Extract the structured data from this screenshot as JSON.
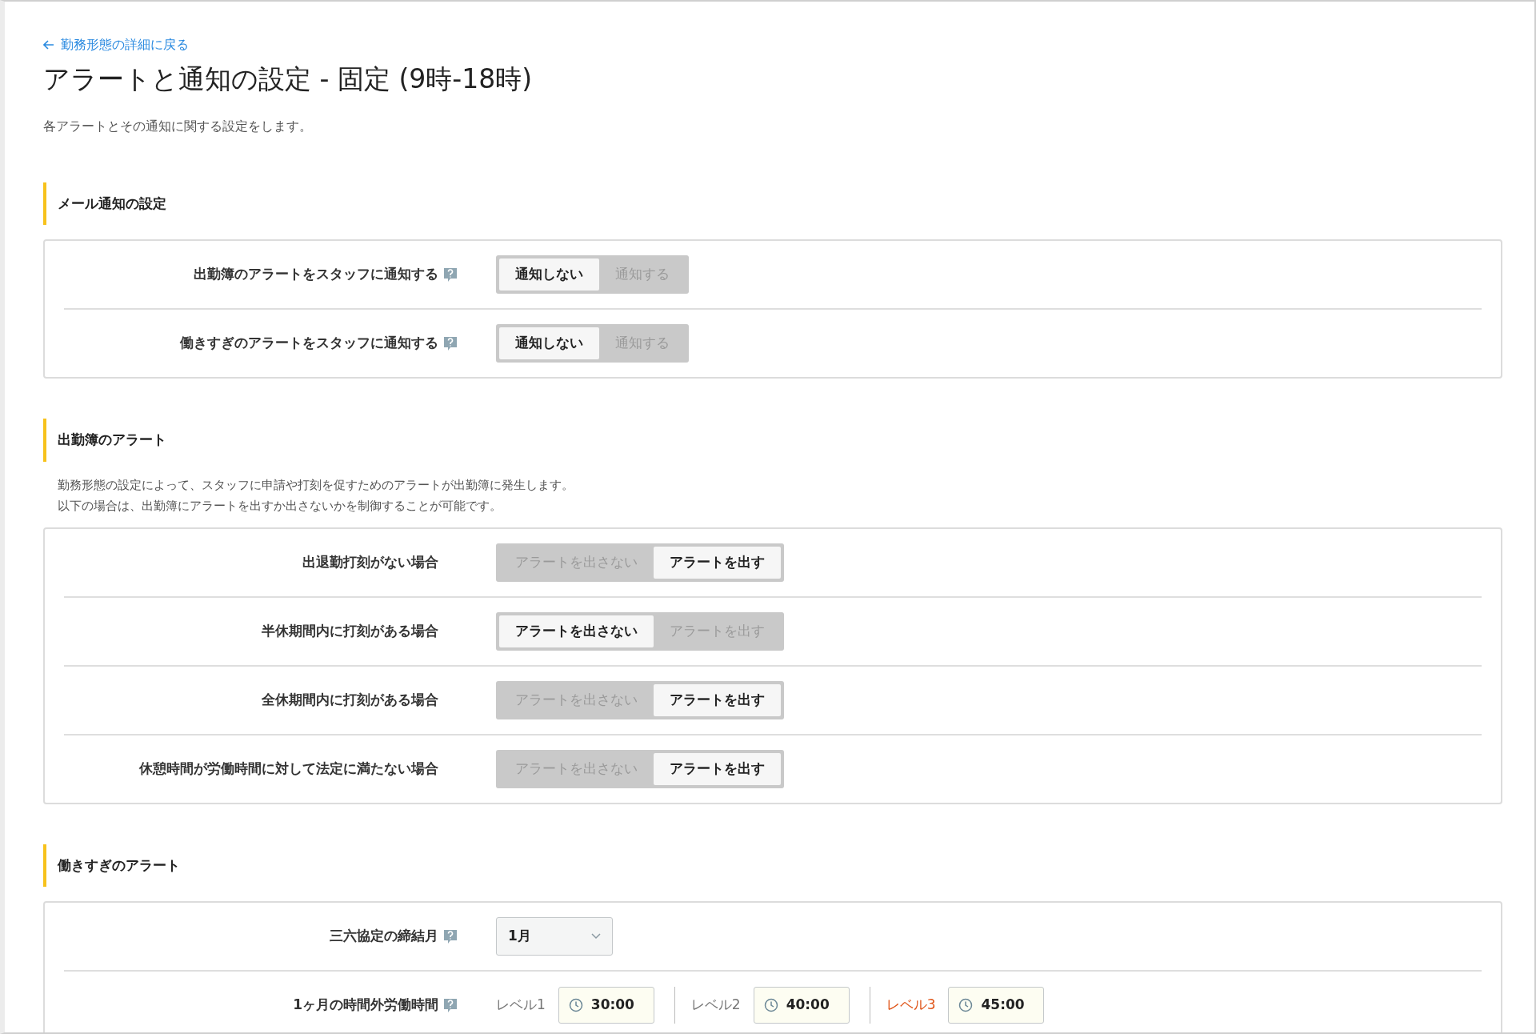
{
  "back_link": "勤務形態の詳細に戻る",
  "title": "アラートと通知の設定 - 固定 (9時-18時)",
  "description": "各アラートとその通知に関する設定をします。",
  "sections": [
    {
      "title": "メール通知の設定",
      "rows": [
        {
          "kind": "toggle",
          "label": "出勤簿のアラートをスタッフに通知する",
          "help": true,
          "options": [
            {
              "label": "通知しない",
              "selected": true
            },
            {
              "label": "通知する",
              "selected": false
            }
          ]
        },
        {
          "kind": "toggle",
          "label": "働きすぎのアラートをスタッフに通知する",
          "help": true,
          "options": [
            {
              "label": "通知しない",
              "selected": true
            },
            {
              "label": "通知する",
              "selected": false
            }
          ]
        }
      ]
    },
    {
      "title": "出勤簿のアラート",
      "description": [
        "勤務形態の設定によって、スタッフに申請や打刻を促すためのアラートが出勤簿に発生します。",
        "以下の場合は、出勤簿にアラートを出すか出さないかを制御することが可能です。"
      ],
      "rows": [
        {
          "kind": "toggle",
          "label": "出退勤打刻がない場合",
          "help": false,
          "options": [
            {
              "label": "アラートを出さない",
              "selected": false
            },
            {
              "label": "アラートを出す",
              "selected": true
            }
          ]
        },
        {
          "kind": "toggle",
          "label": "半休期間内に打刻がある場合",
          "help": false,
          "options": [
            {
              "label": "アラートを出さない",
              "selected": true
            },
            {
              "label": "アラートを出す",
              "selected": false
            }
          ]
        },
        {
          "kind": "toggle",
          "label": "全休期間内に打刻がある場合",
          "help": false,
          "options": [
            {
              "label": "アラートを出さない",
              "selected": false
            },
            {
              "label": "アラートを出す",
              "selected": true
            }
          ]
        },
        {
          "kind": "toggle",
          "label": "休憩時間が労働時間に対して法定に満たない場合",
          "help": false,
          "options": [
            {
              "label": "アラートを出さない",
              "selected": false
            },
            {
              "label": "アラートを出す",
              "selected": true
            }
          ]
        }
      ]
    },
    {
      "title": "働きすぎのアラート",
      "rows": [
        {
          "kind": "select",
          "label": "三六協定の締結月",
          "help": true,
          "value": "1月"
        },
        {
          "kind": "levels",
          "label": "1ヶ月の時間外労働時間",
          "help": true,
          "levels": [
            {
              "label": "レベル1",
              "value": "30:00",
              "color": "#777777"
            },
            {
              "label": "レベル2",
              "value": "40:00",
              "color": "#777777"
            },
            {
              "label": "レベル3",
              "value": "45:00",
              "color": "#e0561a"
            }
          ]
        }
      ]
    }
  ]
}
